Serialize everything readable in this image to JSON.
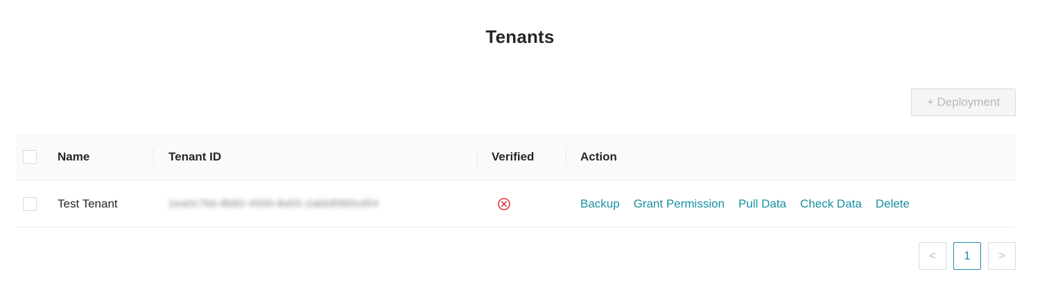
{
  "page": {
    "title": "Tenants"
  },
  "toolbar": {
    "deployment_label": "+ Deployment"
  },
  "table": {
    "columns": [
      "Name",
      "Tenant ID",
      "Verified",
      "Action"
    ],
    "rows": [
      {
        "name": "Test Tenant",
        "tenant_id": "1ea0c7b0-8b82-4500-8a55-2abb8980cd54",
        "verified": false,
        "verified_icon": "x-circle-icon",
        "actions": [
          "Backup",
          "Grant Permission",
          "Pull Data",
          "Check Data",
          "Delete"
        ]
      }
    ]
  },
  "pagination": {
    "prev": "<",
    "current": "1",
    "next": ">"
  },
  "colors": {
    "accent": "#1890a0",
    "error": "#e0343a"
  }
}
